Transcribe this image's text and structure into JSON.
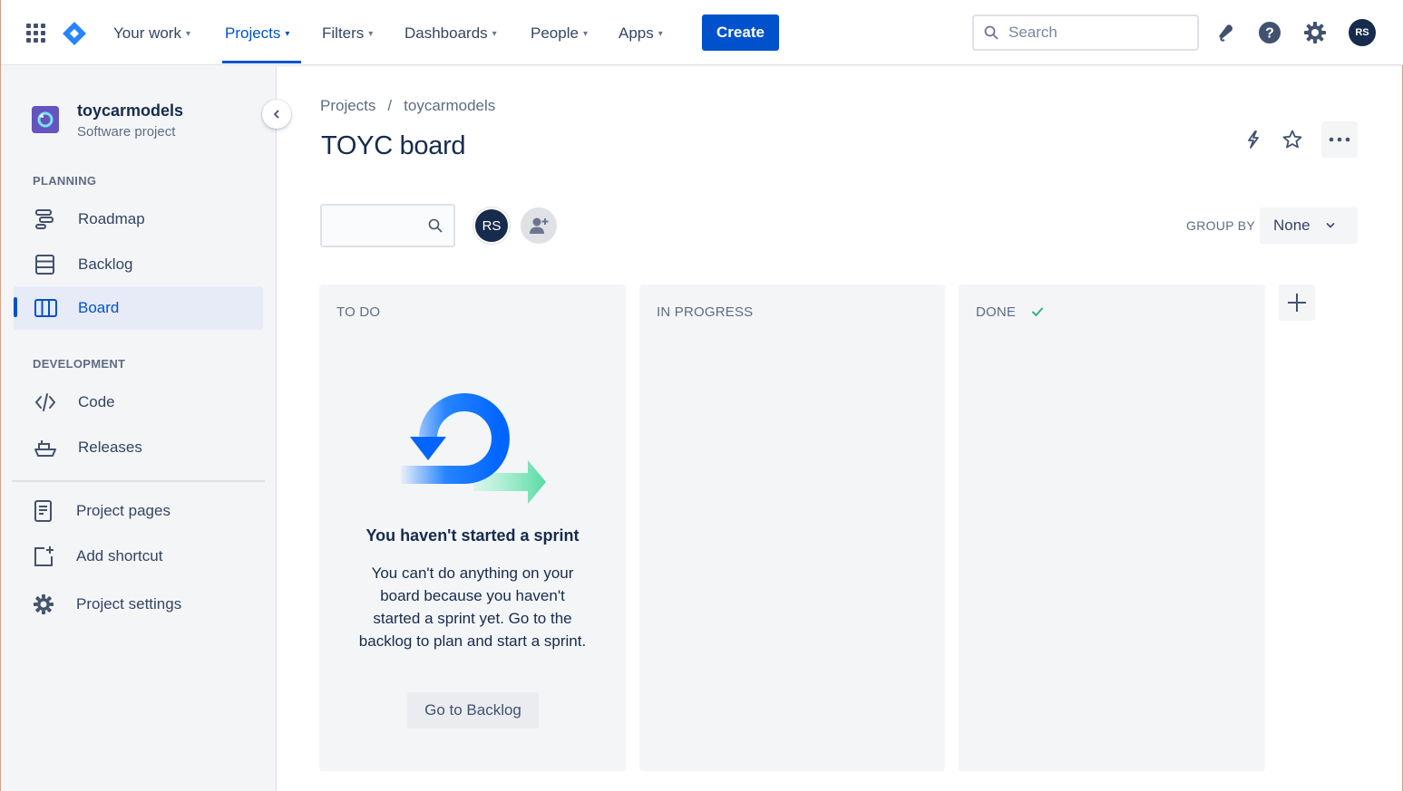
{
  "topnav": {
    "items": [
      {
        "label": "Your work"
      },
      {
        "label": "Projects"
      },
      {
        "label": "Filters"
      },
      {
        "label": "Dashboards"
      },
      {
        "label": "People"
      },
      {
        "label": "Apps"
      }
    ],
    "create_label": "Create",
    "search_placeholder": "Search",
    "user_initials": "RS",
    "icons": [
      "app-switcher-icon",
      "jira-logo-icon",
      "notifications-icon",
      "help-icon",
      "settings-icon"
    ]
  },
  "sidebar": {
    "project_name": "toycarmodels",
    "project_type": "Software project",
    "planning_header": "PLANNING",
    "development_header": "DEVELOPMENT",
    "planning_items": [
      {
        "label": "Roadmap",
        "icon": "roadmap-icon"
      },
      {
        "label": "Backlog",
        "icon": "backlog-icon"
      },
      {
        "label": "Board",
        "icon": "board-icon",
        "active": true
      }
    ],
    "development_items": [
      {
        "label": "Code",
        "icon": "code-icon"
      },
      {
        "label": "Releases",
        "icon": "releases-icon"
      }
    ],
    "bottom_items": [
      {
        "label": "Project pages",
        "icon": "project-pages-icon"
      },
      {
        "label": "Add shortcut",
        "icon": "add-shortcut-icon"
      },
      {
        "label": "Project settings",
        "icon": "settings-icon"
      }
    ]
  },
  "main": {
    "breadcrumb": [
      "Projects",
      "toycarmodels"
    ],
    "breadcrumb_sep": "/",
    "title": "TOYC board",
    "board_avatar": "RS",
    "group_by_label": "GROUP BY",
    "group_by_value": "None",
    "columns": [
      {
        "title": "TO DO"
      },
      {
        "title": "IN PROGRESS"
      },
      {
        "title": "DONE"
      }
    ],
    "empty_state": {
      "title": "You haven't started a sprint",
      "body": "You can't do anything on your board because you haven't started a sprint yet. Go to the backlog to plan and start a sprint.",
      "button": "Go to Backlog"
    }
  },
  "colors": {
    "brand_blue": "#0052cc",
    "text": "#172b4d",
    "subtle_bg": "#f4f5f7",
    "done_check": "#36b37e"
  }
}
